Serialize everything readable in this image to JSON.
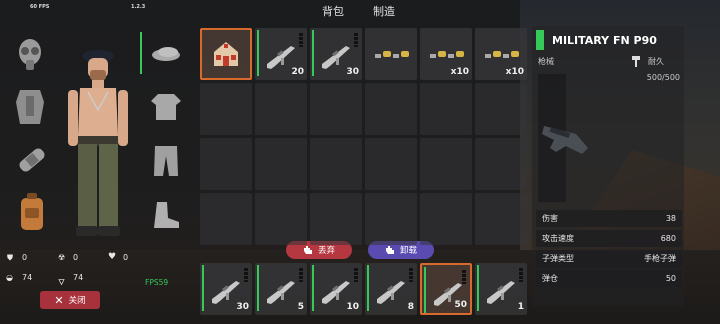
{
  "hud": {
    "fps_top": "60 FPS",
    "version": "1.2.3",
    "fps_bottom": "FPS59"
  },
  "tabs": {
    "backpack": "背包",
    "craft": "制造"
  },
  "stats": {
    "shield": "0",
    "radiation": "0",
    "heart": "0",
    "food": "74",
    "water": "74"
  },
  "inventory": {
    "top_row": [
      {
        "kind": "building",
        "count": "",
        "selected": true
      },
      {
        "kind": "rifle",
        "count": "20",
        "selected": false
      },
      {
        "kind": "rifle",
        "count": "30",
        "selected": false
      },
      {
        "kind": "ammo",
        "count": "",
        "selected": false
      },
      {
        "kind": "ammo",
        "count": "x10",
        "selected": false
      },
      {
        "kind": "ammo",
        "count": "x10",
        "selected": false
      }
    ],
    "hotbar": [
      {
        "count": "30",
        "selected": false
      },
      {
        "count": "5",
        "selected": false
      },
      {
        "count": "10",
        "selected": false
      },
      {
        "count": "8",
        "selected": false
      },
      {
        "count": "50",
        "selected": true
      },
      {
        "count": "1",
        "selected": false
      }
    ]
  },
  "actions": {
    "drop": "丢弃",
    "unload": "卸载",
    "close": "关闭"
  },
  "detail": {
    "name": "MILITARY FN P90",
    "category": "枪械",
    "durability_label": "耐久",
    "durability_value": "500/500",
    "rows": [
      {
        "label": "伤害",
        "value": "38"
      },
      {
        "label": "攻击速度",
        "value": "680"
      },
      {
        "label": "子弹类型",
        "value": "手枪子弹"
      },
      {
        "label": "弹仓",
        "value": "50"
      }
    ]
  },
  "colors": {
    "accent_green": "#36c95a",
    "selection": "#d86a2c",
    "drop": "#b53740",
    "unload": "#5a4bb0"
  }
}
